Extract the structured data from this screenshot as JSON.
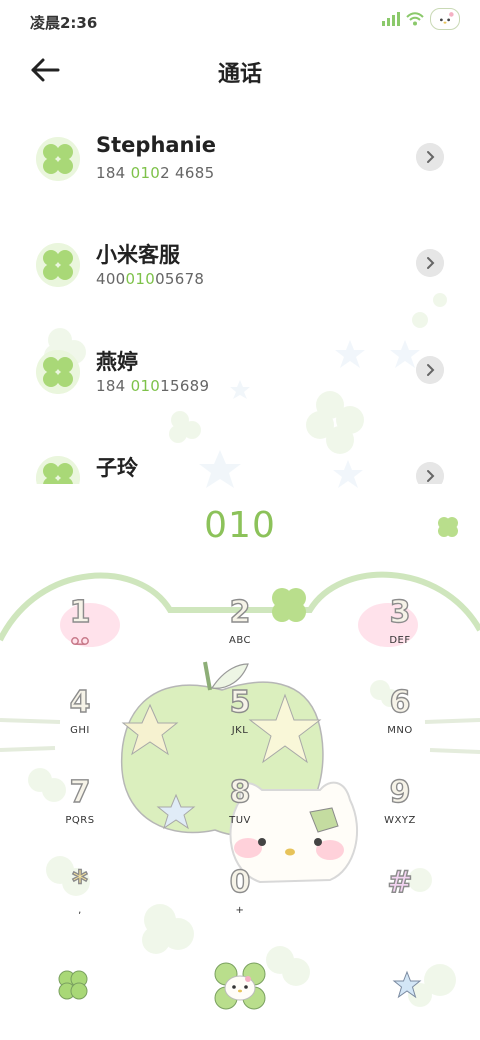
{
  "status": {
    "time": "凌晨2:36"
  },
  "header": {
    "title": "通话"
  },
  "contacts": [
    {
      "name": "Stephanie",
      "num_pre": "184 ",
      "num_hl": "010",
      "num_post": "2 4685"
    },
    {
      "name": "小米客服",
      "num_pre": "400",
      "num_hl": "010",
      "num_post": "05678"
    },
    {
      "name": "燕婷",
      "num_pre": "184 ",
      "num_hl": "010",
      "num_post": "15689"
    },
    {
      "name": "子玲",
      "num_pre": "",
      "num_hl": "",
      "num_post": ""
    }
  ],
  "dialer": {
    "digits": "010",
    "keys": [
      {
        "digit": "1",
        "letters": ""
      },
      {
        "digit": "2",
        "letters": "ABC"
      },
      {
        "digit": "3",
        "letters": "DEF"
      },
      {
        "digit": "4",
        "letters": "GHI"
      },
      {
        "digit": "5",
        "letters": "JKL"
      },
      {
        "digit": "6",
        "letters": "MNO"
      },
      {
        "digit": "7",
        "letters": "PQRS"
      },
      {
        "digit": "8",
        "letters": "TUV"
      },
      {
        "digit": "9",
        "letters": "WXYZ"
      },
      {
        "digit": "*",
        "letters": ","
      },
      {
        "digit": "0",
        "letters": "+"
      },
      {
        "digit": "#",
        "letters": ""
      }
    ]
  },
  "icons": {
    "back": "arrow-left-icon",
    "detail": "chevron-right-icon",
    "voicemail": "voicemail-icon",
    "menu": "clover-menu-icon",
    "call": "kitty-call-icon",
    "hide_keypad": "star-keypad-icon"
  },
  "colors": {
    "accent": "#7ec24a",
    "digits": "#8cc25a",
    "theme_outline": "#cfe6bd"
  }
}
